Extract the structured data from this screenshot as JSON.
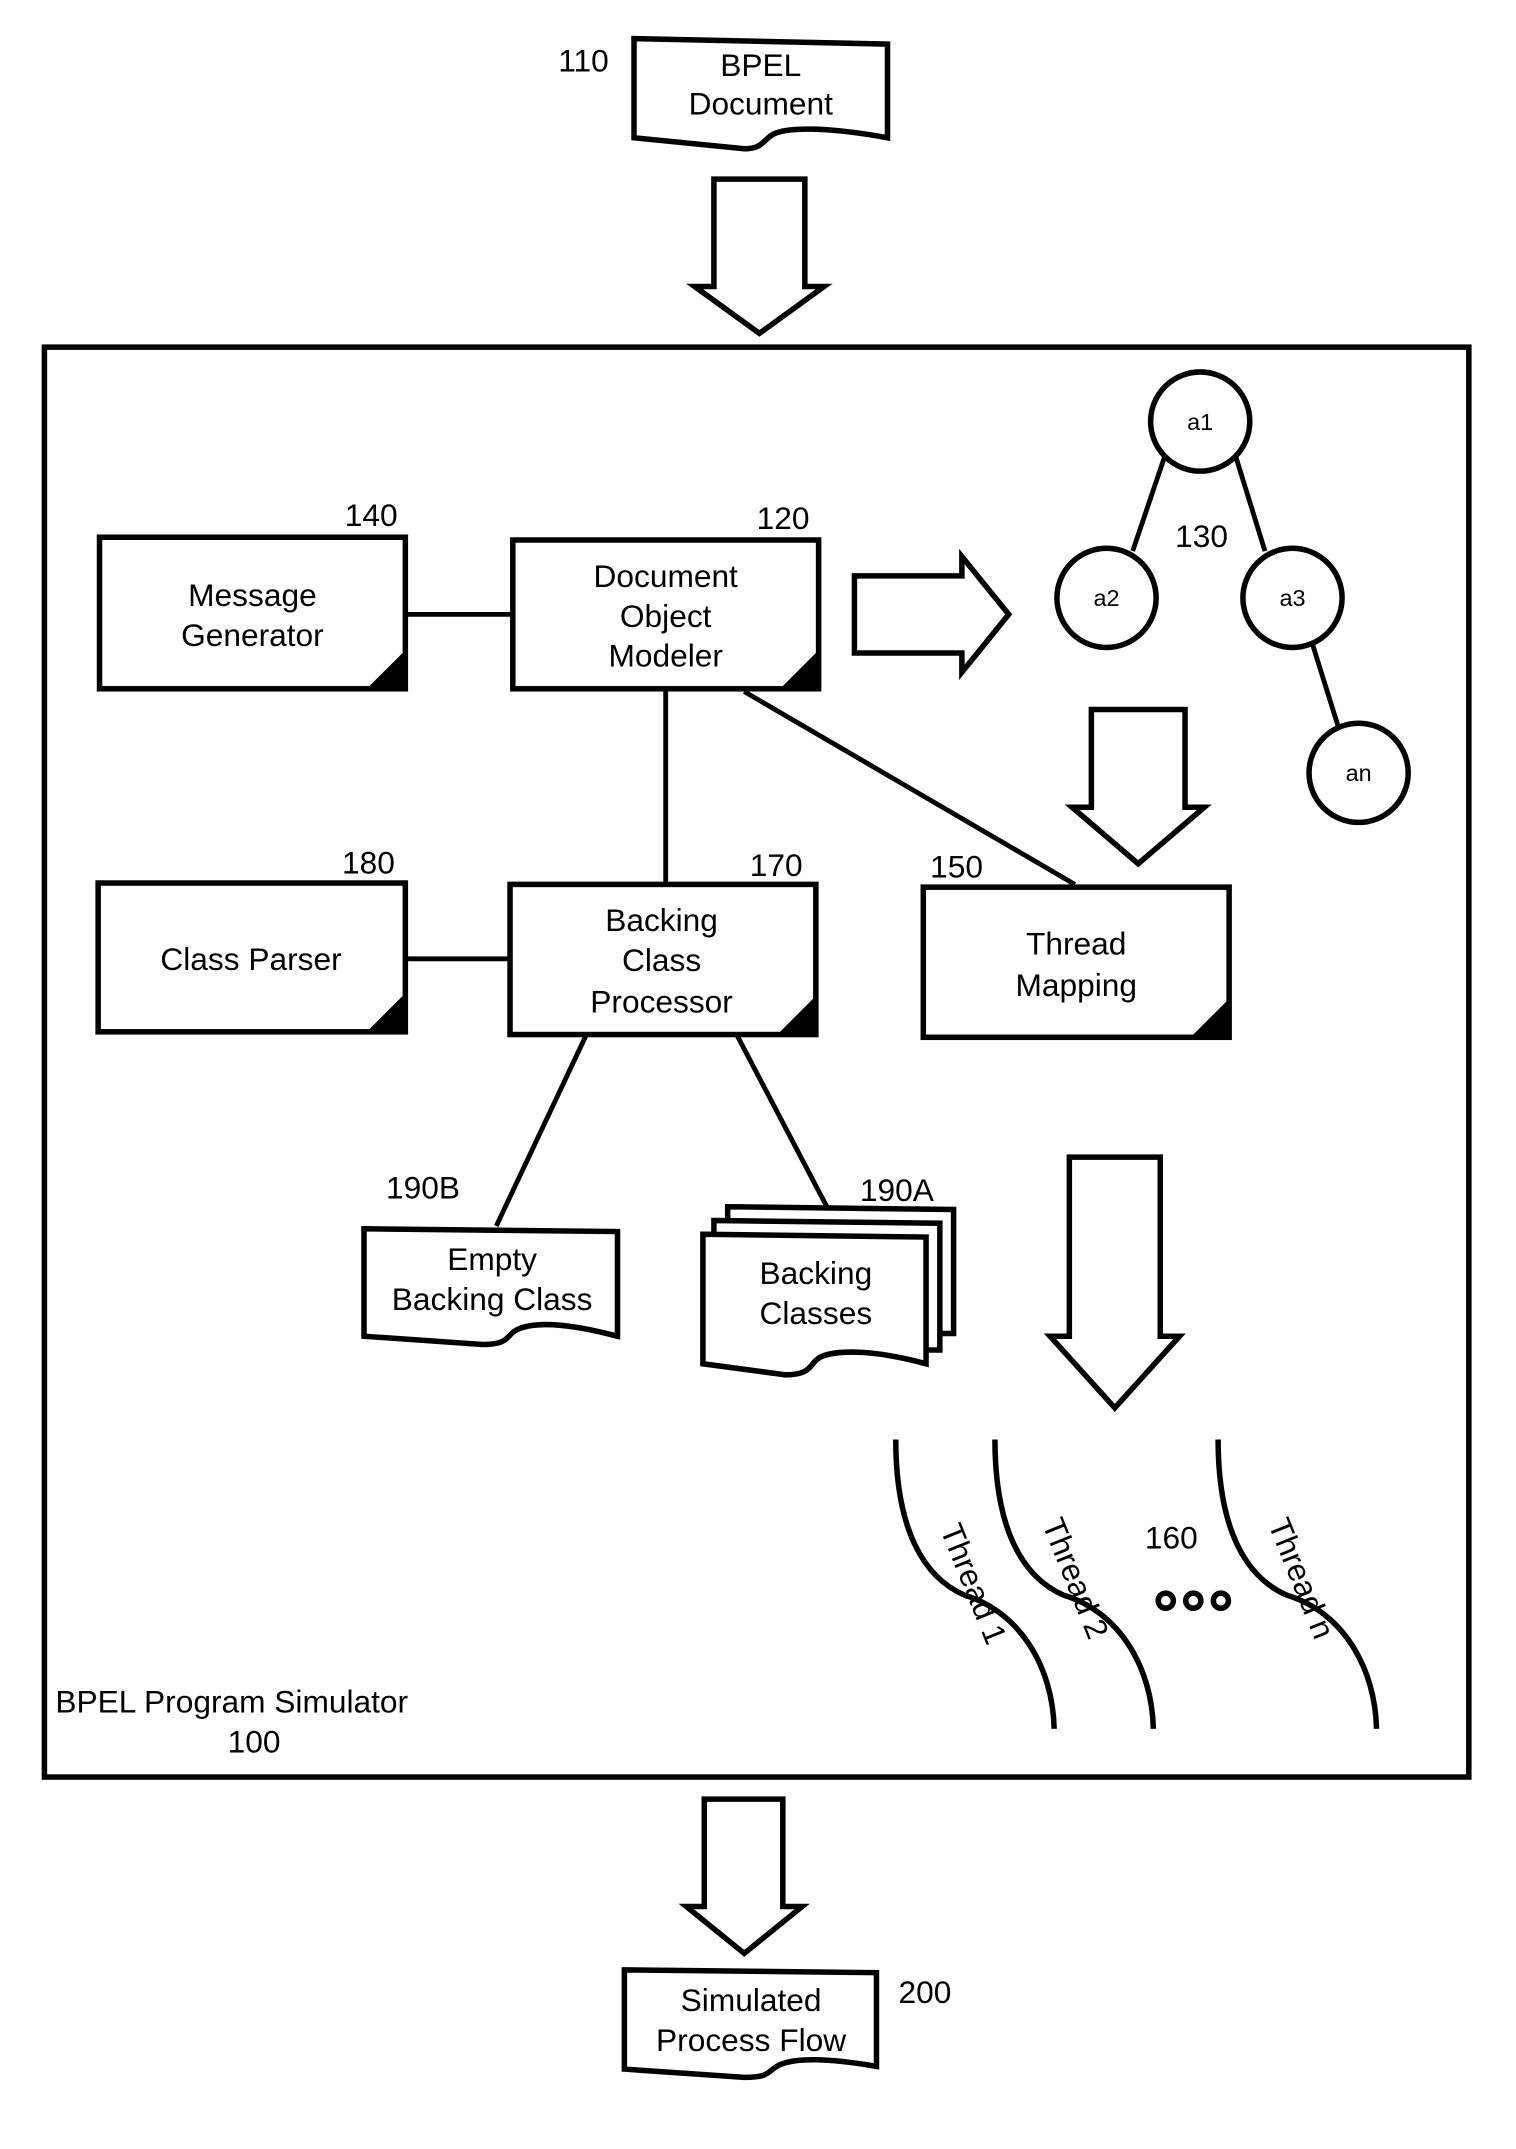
{
  "diagram": {
    "input_document": {
      "ref": "110",
      "line1": "BPEL",
      "line2": "Document"
    },
    "simulator": {
      "label": "BPEL Program Simulator",
      "ref": "100"
    },
    "message_generator": {
      "ref": "140",
      "line1": "Message",
      "line2": "Generator"
    },
    "document_object_modeler": {
      "ref": "120",
      "line1": "Document",
      "line2": "Object",
      "line3": "Modeler"
    },
    "tree": {
      "ref": "130",
      "nodes": [
        "a1",
        "a2",
        "a3",
        "an"
      ]
    },
    "class_parser": {
      "ref": "180",
      "label": "Class Parser"
    },
    "backing_class_processor": {
      "ref": "170",
      "line1": "Backing",
      "line2": "Class",
      "line3": "Processor"
    },
    "thread_mapping": {
      "ref": "150",
      "line1": "Thread",
      "line2": "Mapping"
    },
    "empty_backing_class": {
      "ref": "190B",
      "line1": "Empty",
      "line2": "Backing Class"
    },
    "backing_classes": {
      "ref": "190A",
      "line1": "Backing",
      "line2": "Classes"
    },
    "threads": {
      "ref": "160",
      "items": [
        "Thread 1",
        "Thread 2",
        "Thread n"
      ],
      "ellipsis": "ooo"
    },
    "output_document": {
      "ref": "200",
      "line1": "Simulated",
      "line2": "Process Flow"
    }
  }
}
